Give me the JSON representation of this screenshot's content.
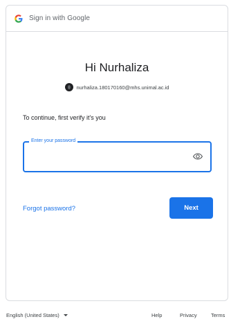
{
  "header": {
    "logo_letter": "G",
    "title": "Sign in with Google"
  },
  "account": {
    "greeting": "Hi Nurhaliza",
    "email": "nurhaliza.180170160@mhs.unimal.ac.id"
  },
  "form": {
    "instruction": "To continue, first verify it's you",
    "password_label": "Enter your password",
    "password_value": "",
    "forgot_label": "Forgot password?",
    "next_label": "Next"
  },
  "footer": {
    "language": "English (United States)",
    "help": "Help",
    "privacy": "Privacy",
    "terms": "Terms"
  },
  "icons": {
    "logo": "google-g-icon",
    "avatar": "avatar",
    "show_password": "eye-icon",
    "language_dropdown": "chevron-down-icon"
  },
  "colors": {
    "accent": "#1a73e8",
    "text": "#202124",
    "muted": "#5f6368",
    "border": "#dadce0"
  }
}
